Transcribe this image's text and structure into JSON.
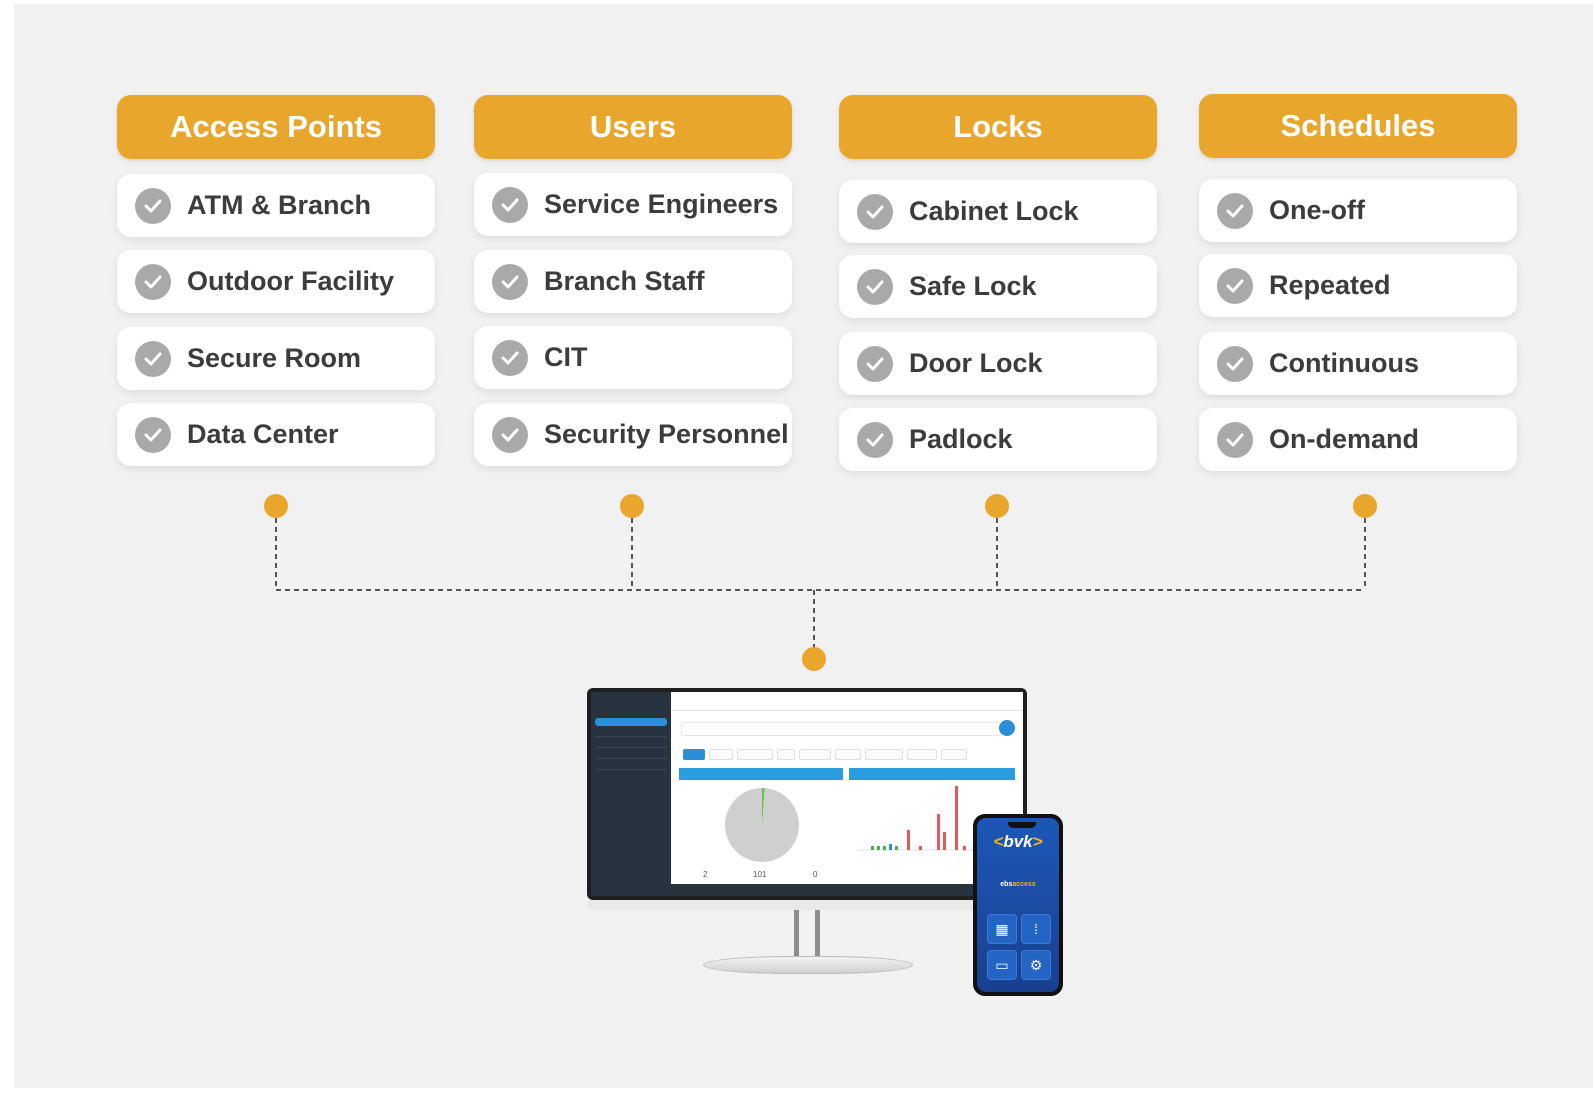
{
  "columns": [
    {
      "title": "Access Points",
      "items": [
        "ATM & Branch",
        "Outdoor Facility",
        "Secure Room",
        "Data Center"
      ]
    },
    {
      "title": "Users",
      "items": [
        "Service Engineers",
        "Branch Staff",
        "CIT",
        "Security Personnel"
      ]
    },
    {
      "title": "Locks",
      "items": [
        "Cabinet Lock",
        "Safe Lock",
        "Door Lock",
        "Padlock"
      ]
    },
    {
      "title": "Schedules",
      "items": [
        "One-off",
        "Repeated",
        "Continuous",
        "On-demand"
      ]
    }
  ],
  "colors": {
    "header": "#e8a62d",
    "dot": "#e8a62d",
    "check": "#a9a9a9",
    "connector": "#555555"
  },
  "dashboard": {
    "stats": [
      "2",
      "101",
      "0"
    ]
  },
  "phone": {
    "logo_text": "bvk",
    "app_name_prefix": "ebs",
    "app_name_suffix": "access"
  }
}
